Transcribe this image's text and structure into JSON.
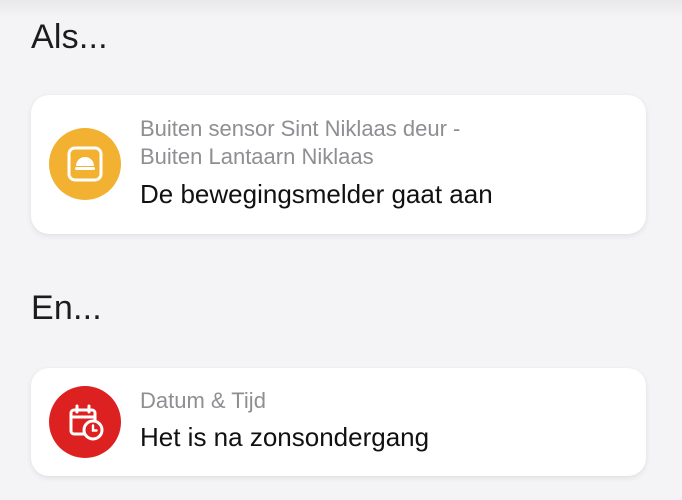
{
  "sections": {
    "if_heading": "Als...",
    "and_heading": "En..."
  },
  "trigger_card": {
    "icon": "motion-sensor-icon",
    "icon_color": "#F2B130",
    "subtitle_line1": "Buiten sensor Sint Niklaas deur -",
    "subtitle_line2": "Buiten Lantaarn Niklaas",
    "title": "De bewegingsmelder gaat aan"
  },
  "condition_card": {
    "icon": "calendar-clock-icon",
    "icon_color": "#DD2020",
    "subtitle": "Datum & Tijd",
    "title": "Het is na zonsondergang"
  }
}
